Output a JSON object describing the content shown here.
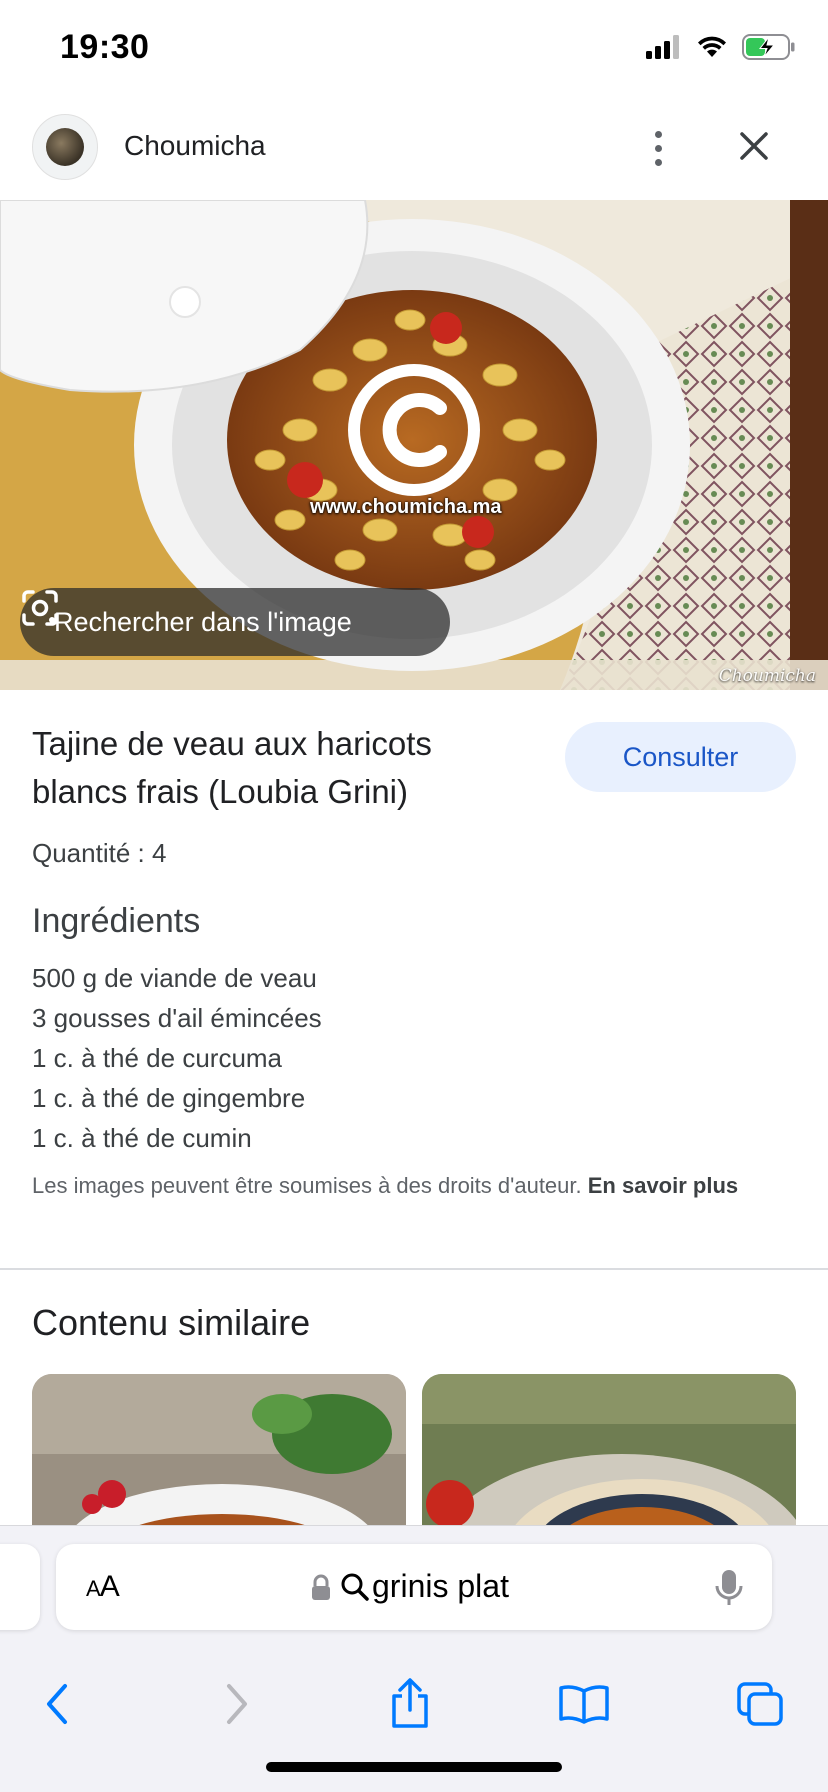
{
  "status_bar": {
    "time": "19:30"
  },
  "header": {
    "site_name": "Choumicha"
  },
  "hero": {
    "watermark_url": "www.choumicha.ma",
    "lens_label": "Rechercher dans l'image",
    "brand_mark": "Choumicha"
  },
  "recipe": {
    "title": "Tajine de veau aux haricots blancs frais (Loubia Grini)",
    "consult_label": "Consulter",
    "quantity": "Quantité : 4",
    "ingredients_heading": "Ingrédients",
    "ingredients": [
      "500 g de viande de veau",
      "3 gousses d'ail émincées",
      "1 c. à thé de curcuma",
      "1 c. à thé de gingembre",
      "1 c. à thé de cumin"
    ],
    "copyright_note": "Les images peuvent être soumises à des droits d'auteur.",
    "learn_more": "En savoir plus"
  },
  "similar": {
    "heading": "Contenu similaire"
  },
  "safari": {
    "aa_big": "A",
    "aa_small": "A",
    "address": "grinis plat"
  },
  "colors": {
    "accent": "#1a56c7",
    "consult_bg": "#e8f0fe",
    "ios_blue": "#007aff",
    "ios_disabled": "#b8b8bd"
  }
}
